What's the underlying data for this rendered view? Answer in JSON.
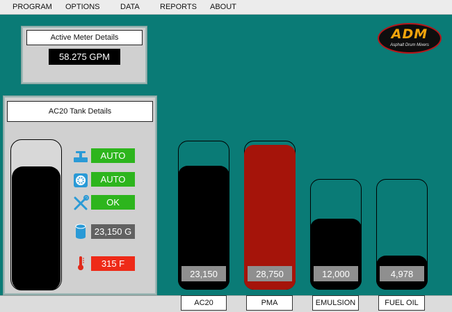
{
  "menu": {
    "items": [
      "PROGRAM",
      "OPTIONS",
      "DATA",
      "REPORTS",
      "ABOUT"
    ]
  },
  "meter": {
    "title": "Active Meter Details",
    "value": "58.275 GPM"
  },
  "tank_details": {
    "title": "AC20 Tank Details",
    "fill_fraction": 0.82,
    "statuses": [
      {
        "icon": "valve-icon",
        "value": "AUTO",
        "color": "#2db51d"
      },
      {
        "icon": "pump-icon",
        "value": "AUTO",
        "color": "#2db51d"
      },
      {
        "icon": "tools-icon",
        "value": "OK",
        "color": "#2db51d"
      },
      {
        "icon": "tank-level-icon",
        "value": "23,150 G",
        "color": "#616161"
      },
      {
        "icon": "thermometer-icon",
        "value": "315 F",
        "color": "#ee2a18"
      }
    ]
  },
  "logo": {
    "text": "ADM",
    "subtitle": "Asphalt Drum Mixers"
  },
  "tanks": [
    {
      "label": "AC20",
      "value": "23,150",
      "fill_fraction": 0.83,
      "fill_color": "#000000"
    },
    {
      "label": "PMA",
      "value": "28,750",
      "fill_fraction": 0.97,
      "fill_color": "#a5140a"
    },
    {
      "label": "EMULSION",
      "value": "12,000",
      "fill_fraction": 0.64,
      "fill_color": "#000000"
    },
    {
      "label": "FUEL OIL",
      "value": "4,978",
      "fill_fraction": 0.31,
      "fill_color": "#000000"
    }
  ]
}
